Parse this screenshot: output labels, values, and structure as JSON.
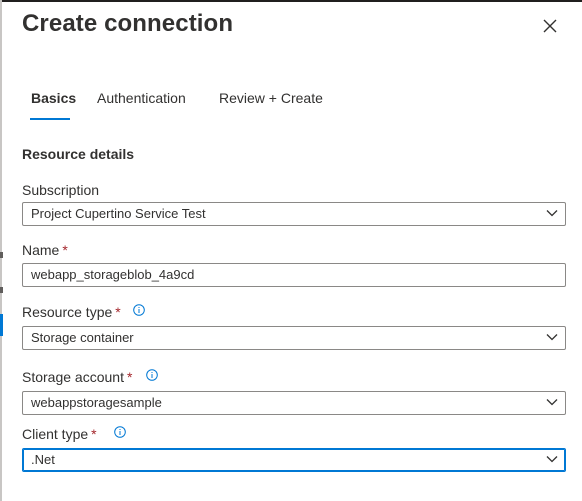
{
  "dialog": {
    "title": "Create connection",
    "close_icon": "close-icon"
  },
  "tabs": [
    {
      "label": "Basics",
      "selected": true
    },
    {
      "label": "Authentication",
      "selected": false
    },
    {
      "label": "Review + Create",
      "selected": false
    }
  ],
  "section": {
    "title": "Resource details"
  },
  "fields": {
    "subscription": {
      "label": "Subscription",
      "value": "Project Cupertino Service Test",
      "icon": "chevron-down-icon"
    },
    "name": {
      "label": "Name",
      "required": "*",
      "value": "webapp_storageblob_4a9cd"
    },
    "resource_type": {
      "label": "Resource type",
      "required": "*",
      "value": "Storage container",
      "info_icon": "info-icon",
      "icon": "chevron-down-icon"
    },
    "storage_account": {
      "label": "Storage account",
      "required": "*",
      "value": "webappstoragesample",
      "info_icon": "info-icon",
      "icon": "chevron-down-icon"
    },
    "client_type": {
      "label": "Client type",
      "required": "*",
      "value": ".Net",
      "info_icon": "info-icon",
      "icon": "chevron-down-icon"
    }
  },
  "colors": {
    "accent": "#0078d4",
    "required": "#a4262c",
    "text": "#323130",
    "border": "#8a8886"
  }
}
